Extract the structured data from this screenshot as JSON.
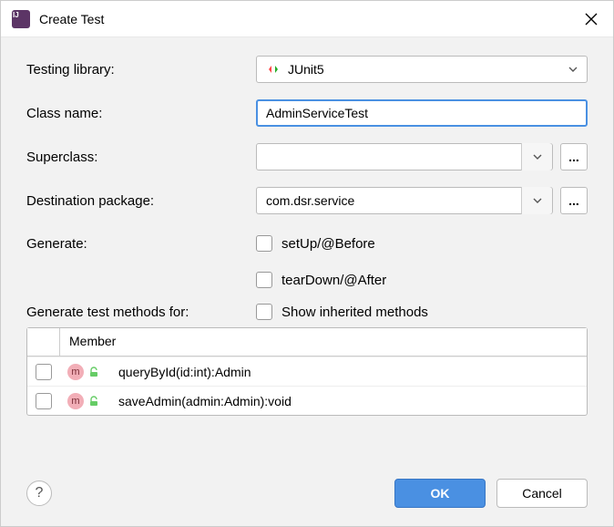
{
  "window": {
    "title": "Create Test"
  },
  "form": {
    "testing_library": {
      "label": "Testing library:",
      "value": "JUnit5"
    },
    "class_name": {
      "label": "Class name:",
      "value": "AdminServiceTest"
    },
    "superclass": {
      "label": "Superclass:",
      "value": ""
    },
    "destination_package": {
      "label": "Destination package:",
      "value": "com.dsr.service"
    },
    "generate_label": "Generate:",
    "setup_label": "setUp/@Before",
    "teardown_label": "tearDown/@After",
    "generate_methods_label": "Generate test methods for:",
    "show_inherited_label": "Show inherited methods",
    "member_header": "Member",
    "ellipsis": "..."
  },
  "methods": [
    {
      "signature": "queryById(id:int):Admin"
    },
    {
      "signature": "saveAdmin(admin:Admin):void"
    }
  ],
  "buttons": {
    "ok": "OK",
    "cancel": "Cancel",
    "help": "?"
  }
}
